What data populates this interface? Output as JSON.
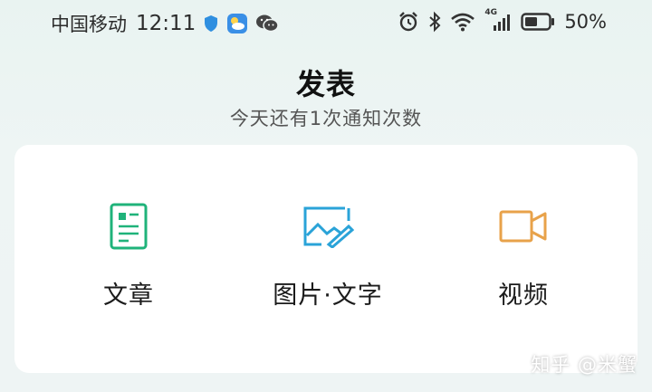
{
  "status_bar": {
    "carrier": "中国移动",
    "time": "12:11",
    "network_type": "4G",
    "battery_percent": "50%",
    "icons": [
      "shield-icon",
      "weather-app-icon",
      "wechat-icon",
      "alarm-icon",
      "bluetooth-icon",
      "wifi-icon",
      "signal-icon",
      "battery-icon"
    ]
  },
  "header": {
    "title": "发表",
    "subtitle": "今天还有1次通知次数"
  },
  "options": [
    {
      "label": "文章",
      "icon": "article-icon",
      "color": "#1fb37a"
    },
    {
      "label": "图片·文字",
      "icon": "image-text-icon",
      "color": "#2aa3d8"
    },
    {
      "label": "视频",
      "icon": "video-icon",
      "color": "#e8a24a"
    }
  ],
  "watermark": "知乎 @米蟹"
}
